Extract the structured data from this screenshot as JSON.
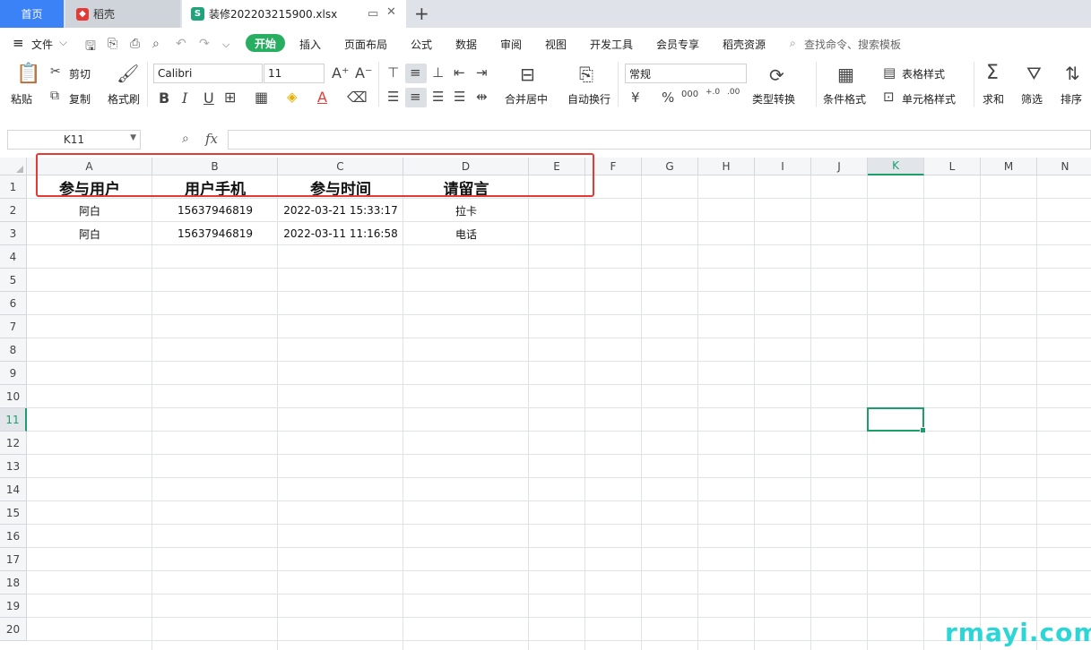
{
  "tabs": {
    "home": "首页",
    "daoke": "稻壳",
    "file": "装修202203215900.xlsx"
  },
  "menu": {
    "file": "文件",
    "start": "开始",
    "insert": "插入",
    "layout": "页面布局",
    "formula": "公式",
    "data": "数据",
    "review": "审阅",
    "view": "视图",
    "dev": "开发工具",
    "member": "会员专享",
    "resources": "稻壳资源",
    "search": "查找命令、搜索模板"
  },
  "ribbon": {
    "paste": "粘贴",
    "cut": "剪切",
    "copy": "复制",
    "format_painter": "格式刷",
    "font": "Calibri",
    "size": "11",
    "merge": "合并居中",
    "wrap": "自动换行",
    "number_format": "常规",
    "convert": "类型转换",
    "cond_format": "条件格式",
    "table_style": "表格样式",
    "cell_style": "单元格样式",
    "sum": "求和",
    "filter": "筛选",
    "sort": "排序"
  },
  "namebox": "K11",
  "columns": [
    "A",
    "B",
    "C",
    "D",
    "E",
    "F",
    "G",
    "H",
    "I",
    "J",
    "K",
    "L",
    "M",
    "N"
  ],
  "rows": [
    "1",
    "2",
    "3",
    "4",
    "5",
    "6",
    "7",
    "8",
    "9",
    "10",
    "11",
    "12",
    "13",
    "14",
    "15",
    "16",
    "17",
    "18",
    "19",
    "20"
  ],
  "headers": [
    "参与用户",
    "用户手机",
    "参与时间",
    "请留言"
  ],
  "data_rows": [
    [
      "阿白",
      "15637946819",
      "2022-03-21 15:33:17",
      "拉卡"
    ],
    [
      "阿白",
      "15637946819",
      "2022-03-11 11:16:58",
      "电话"
    ]
  ],
  "watermark": "rmayi.com",
  "colors": {
    "accent": "#27ae60",
    "highlight": "#e53935",
    "home_tab": "#3b82f6"
  }
}
